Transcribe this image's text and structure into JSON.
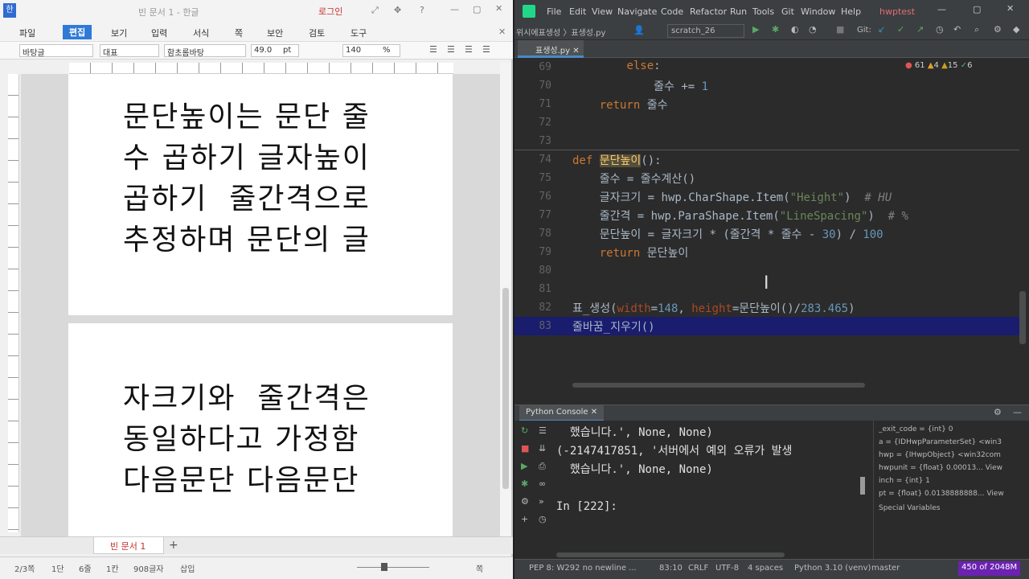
{
  "hwp": {
    "title": "빈 문서 1 - 한글",
    "login": "로그인",
    "menu": [
      "파일",
      "편집",
      "보기",
      "입력",
      "서식",
      "쪽",
      "보안",
      "검토",
      "도구"
    ],
    "format": {
      "style": "바탕글",
      "font_lang": "대표",
      "font": "함초롬바탕",
      "size": "49.0",
      "unit": "pt",
      "ratio": "140",
      "ratio_unit": "%"
    },
    "page1_text": "문단높이는 문단 줄\n수 곱하기 글자높이\n곱하기  줄간격으로\n추정하며 문단의 글",
    "page2_text": "자크기와  줄간격은\n동일하다고 가정함\n다음문단 다음문단",
    "doc_tab": "빈 문서 1",
    "status": [
      "2/3쪽",
      "1단",
      "6줄",
      "1칸",
      "908글자",
      "삽입"
    ],
    "zoom_label": "쪽"
  },
  "pycharm": {
    "menu": [
      "File",
      "Edit",
      "View",
      "Navigate",
      "Code",
      "Refactor",
      "Run",
      "Tools",
      "Git",
      "Window",
      "Help"
    ],
    "project": "hwptest",
    "breadcrumb": "위시에표생성 〉표생성.py",
    "run_config": "scratch_26",
    "git_label": "Git:",
    "file_tab": "표생성.py",
    "inspections": {
      "errors": "61",
      "warnings": "4",
      "weak": "15",
      "ok": "6"
    },
    "lines": [
      {
        "n": "69",
        "html": "        <span class=\"kw\">else</span>:"
      },
      {
        "n": "70",
        "html": "            줄수 += <span class=\"num\">1</span>"
      },
      {
        "n": "71",
        "html": "    <span class=\"kw\">return</span> 줄수"
      },
      {
        "n": "72",
        "html": ""
      },
      {
        "n": "73",
        "html": ""
      },
      {
        "n": "74",
        "html": "<span class=\"kw\">def</span> <span class=\"fn\" style=\"background:#52503a\">문단높이</span>():"
      },
      {
        "n": "75",
        "html": "    줄수 = 줄수계산()"
      },
      {
        "n": "76",
        "html": "    글자크기 = hwp.CharShape.Item(<span class=\"str\">\"Height\"</span>)  <span class=\"cm\"># HU</span>"
      },
      {
        "n": "77",
        "html": "    줄간격 = hwp.ParaShape.Item(<span class=\"str\">\"LineSpacing\"</span>)  <span class=\"cm\"># %</span>"
      },
      {
        "n": "78",
        "html": "    문단높이 = 글자크기 * (줄간격 * 줄수 - <span class=\"num\">30</span>) / <span class=\"num\">100</span>"
      },
      {
        "n": "79",
        "html": "    <span class=\"kw\">return</span> 문단높이"
      },
      {
        "n": "80",
        "html": ""
      },
      {
        "n": "81",
        "html": ""
      },
      {
        "n": "82",
        "html": "표_생성(<span class=\"pm\">width</span>=<span class=\"num\">148</span>, <span class=\"pm\">height</span>=문단높이()/<span class=\"num\">283.465</span>)"
      },
      {
        "n": "83",
        "html": "줄바꿈_지우기()"
      }
    ],
    "console_tab": "Python Console",
    "console_lines": "  했습니다.', None, None)\n(-2147417851, '서버에서 예외 오류가 발생\n  했습니다.', None, None)\n\nIn [222]:",
    "vars": [
      "_exit_code = {int} 0",
      "a = {IDHwpParameterSet} <win3",
      "hwp = {IHwpObject} <win32com",
      "hwpunit = {float} 0.00013... View",
      "inch = {int} 1",
      "pt = {float} 0.0138888888... View",
      "Special Variables"
    ],
    "status": {
      "pep": "PEP 8: W292 no newline ...",
      "pos": "83:10",
      "eol": "CRLF",
      "enc": "UTF-8",
      "indent": "4 spaces",
      "interp": "Python 3.10 (venv)",
      "branch": "master",
      "mem": "450 of 2048M"
    }
  }
}
